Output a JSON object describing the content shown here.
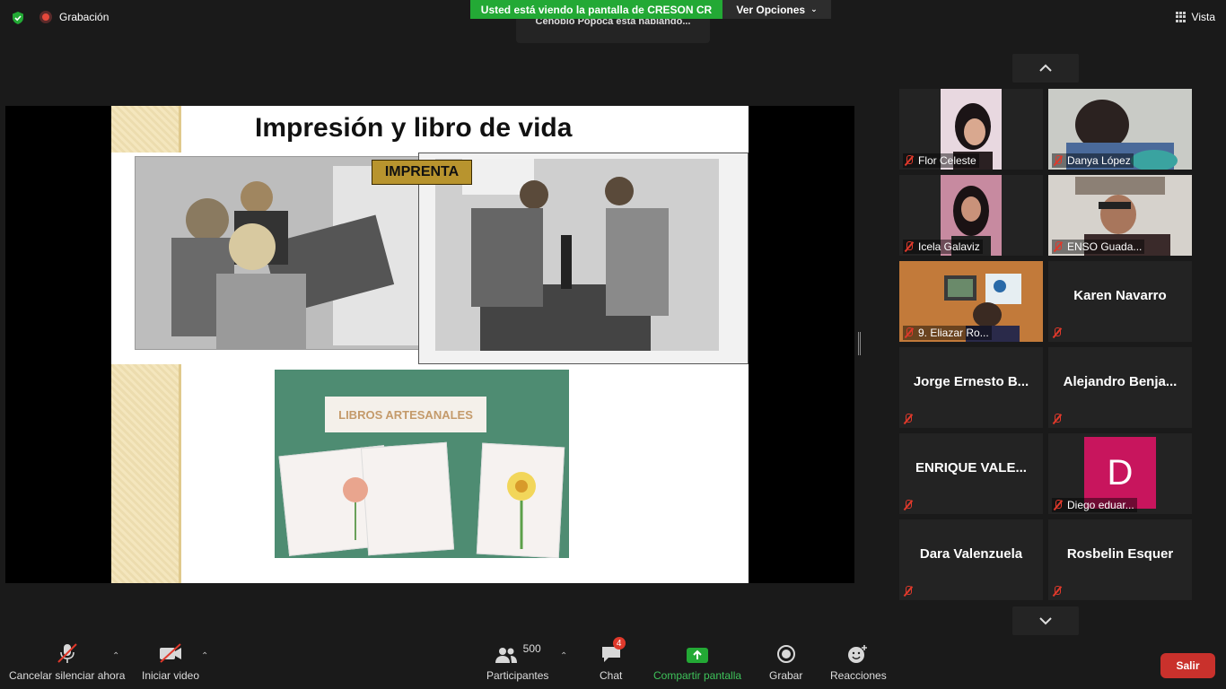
{
  "top": {
    "recording_label": "Grabación",
    "banner_text": "Usted está viendo la pantalla de CRESON CR",
    "view_options": "Ver Opciones",
    "speaking": "Cenobio Popoca está hablando...",
    "view_label": "Vista"
  },
  "slide": {
    "title": "Impresión y libro de vida",
    "imprenta_label": "IMPRENTA",
    "libros_label": "LIBROS ARTESANALES"
  },
  "participants": [
    {
      "name": "Flor Celeste",
      "video": true
    },
    {
      "name": "Danya López",
      "video": true
    },
    {
      "name": "Icela Galaviz",
      "video": true
    },
    {
      "name": "ENSO Guada...",
      "video": true
    },
    {
      "name": "9. Eliazar Ro...",
      "video": true
    },
    {
      "name": "Karen Navarro",
      "video": false
    },
    {
      "name": "Jorge Ernesto B...",
      "video": false
    },
    {
      "name": "Alejandro  Benja...",
      "video": false
    },
    {
      "name": "ENRIQUE VALE...",
      "video": false
    },
    {
      "name": "Diego eduar...",
      "video": false,
      "avatar": "D"
    },
    {
      "name": "Dara Valenzuela",
      "video": false
    },
    {
      "name": "Rosbelin Esquer",
      "video": false
    }
  ],
  "toolbar": {
    "mute": "Cancelar silenciar ahora",
    "video": "Iniciar video",
    "participants_count": "500",
    "participants": "Participantes",
    "chat_badge": "4",
    "chat": "Chat",
    "share": "Compartir pantalla",
    "record": "Grabar",
    "reactions": "Reacciones",
    "leave": "Salir"
  },
  "colors": {
    "share_green": "#23a935",
    "leave_red": "#c9312c",
    "avatar_pink": "#c8155d"
  }
}
